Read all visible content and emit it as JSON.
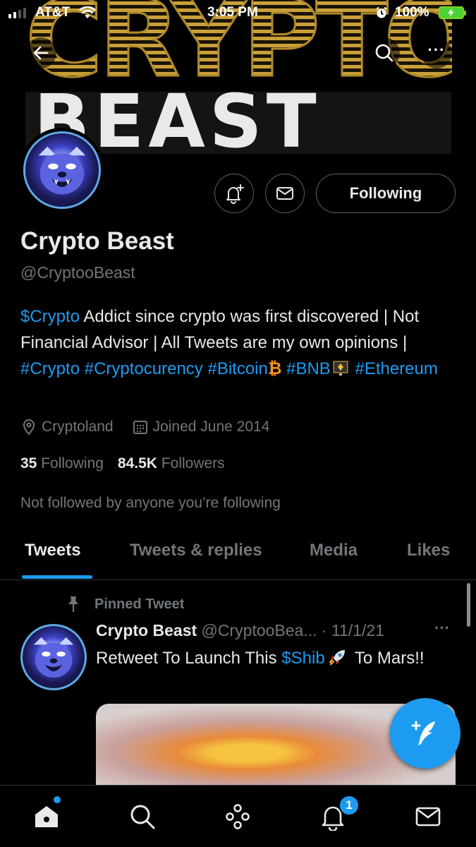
{
  "status_bar": {
    "carrier": "AT&T",
    "time": "3:05 PM",
    "battery": "100%"
  },
  "banner": {
    "line1": "CRYPTO",
    "line2": "BEAST"
  },
  "profile": {
    "display_name": "Crypto Beast",
    "handle": "@CryptooBeast",
    "following_button": "Following",
    "bio": {
      "link1": "$Crypto",
      "text1": " Addict since crypto was first discovered | Not Financial Advisor | All Tweets are my own opinions | ",
      "tag1": "#Crypto",
      "tag2": "#Cryptocurency",
      "tag3": "#Bitcoin",
      "btc_symbol": "₿",
      "tag4": "#BNB",
      "tag5": "#Ethereum"
    },
    "location": "Cryptoland",
    "joined": "Joined June 2014",
    "following_count": "35",
    "following_label": "Following",
    "followers_count": "84.5K",
    "followers_label": "Followers",
    "not_followed_text": "Not followed by anyone you’re following"
  },
  "tabs": [
    "Tweets",
    "Tweets & replies",
    "Media",
    "Likes"
  ],
  "tweet": {
    "pinned_label": "Pinned Tweet",
    "author": "Crypto Beast",
    "handle_date": "@CryptooBea... · 11/1/21",
    "more": "···",
    "text_before": "Retweet To Launch This ",
    "link": "$Shib",
    "text_after": " To Mars!!"
  },
  "bottom_nav": {
    "notifications_badge": "1"
  },
  "colors": {
    "accent": "#1d9bf0",
    "background": "#000000",
    "muted": "#71767b",
    "border": "#2f3336"
  },
  "icons": [
    "back-arrow-icon",
    "search-icon",
    "more-icon",
    "bell-plus-icon",
    "envelope-icon",
    "location-pin-icon",
    "calendar-icon",
    "pin-icon",
    "compose-feather-icon",
    "home-icon",
    "spaces-icon",
    "bell-icon"
  ]
}
